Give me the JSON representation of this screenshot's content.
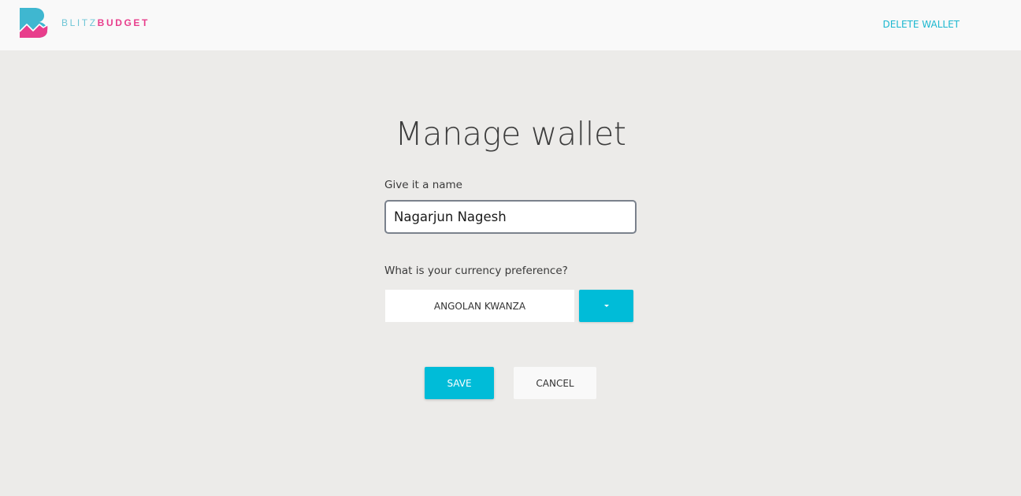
{
  "app": {
    "brand_light": "BLITZ",
    "brand_bold": "BUDGET"
  },
  "header": {
    "delete_label": "DELETE WALLET"
  },
  "page": {
    "title": "Manage wallet"
  },
  "form": {
    "name_label": "Give it a name",
    "name_value": "Nagarjun Nagesh",
    "currency_label": "What is your currency preference?",
    "currency_value": "ANGOLAN KWANZA"
  },
  "actions": {
    "save_label": "SAVE",
    "cancel_label": "CANCEL"
  },
  "icons": {
    "logo": "blitzbudget-logo-icon",
    "dropdown": "caret-down-icon"
  },
  "colors": {
    "accent": "#00bcd8",
    "brand_pink": "#e83e8c",
    "brand_teal": "#6fc6d6",
    "background": "#ecebe9"
  }
}
